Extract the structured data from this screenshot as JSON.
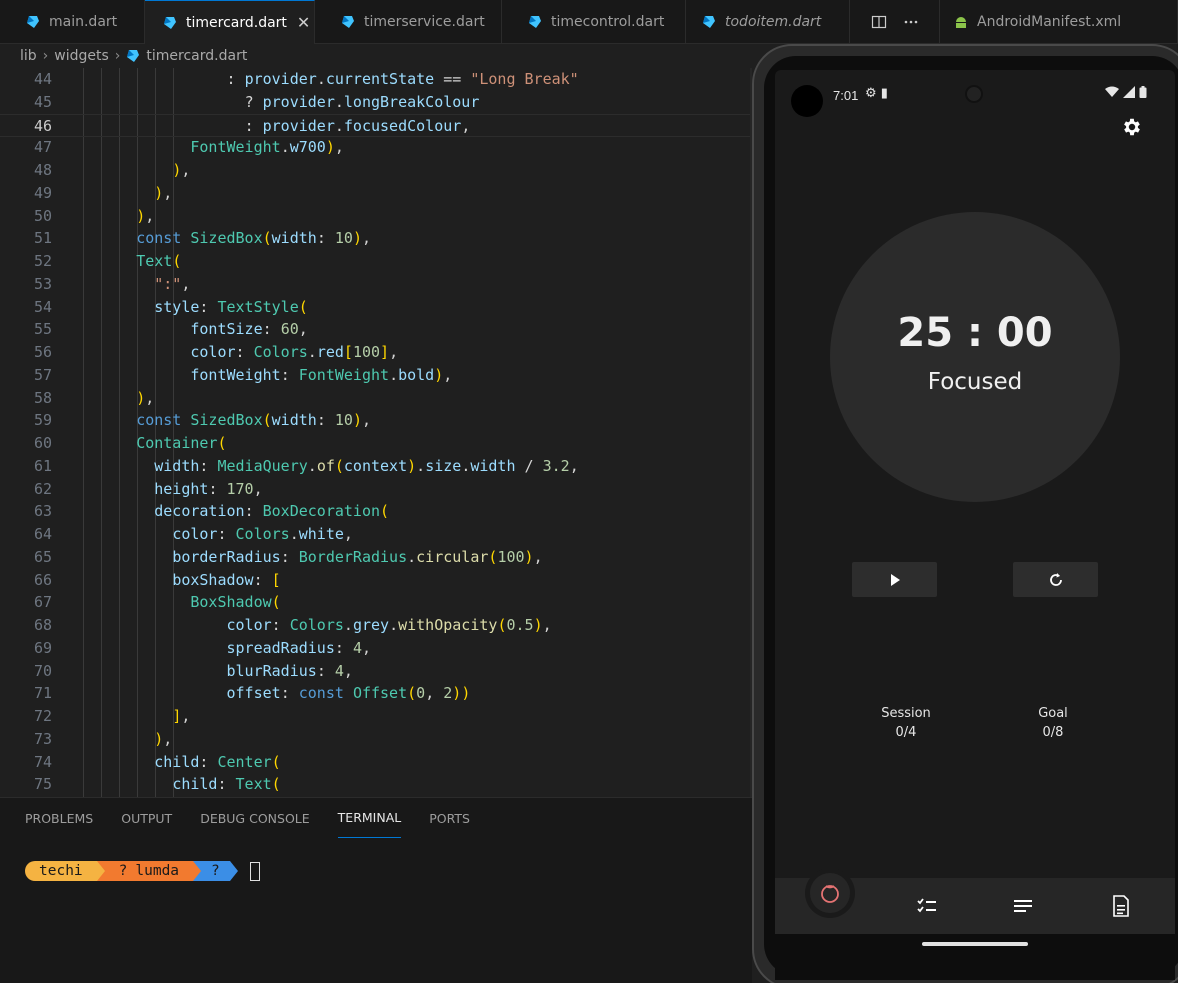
{
  "tabs": [
    {
      "label": "main.dart",
      "active": false,
      "italic": false
    },
    {
      "label": "timercard.dart",
      "active": true,
      "italic": false
    },
    {
      "label": "timerservice.dart",
      "active": false,
      "italic": false
    },
    {
      "label": "timecontrol.dart",
      "active": false,
      "italic": false
    },
    {
      "label": "todoitem.dart",
      "active": false,
      "italic": true
    },
    {
      "label": "AndroidManifest.xml",
      "active": false,
      "italic": false
    }
  ],
  "tab_close_symbol": "✕",
  "tab_action_icons": [
    "split-editor-icon",
    "more-icon"
  ],
  "breadcrumb": {
    "lib": "lib",
    "widgets": "widgets",
    "file": "timercard.dart"
  },
  "editor": {
    "current_line": 46,
    "lines": [
      {
        "n": "44",
        "text": "                : provider.currentState == \"Long Break\""
      },
      {
        "n": "45",
        "text": "                  ? provider.longBreakColour"
      },
      {
        "n": "46",
        "text": "                  : provider.focusedColour,"
      },
      {
        "n": "47",
        "text": "            FontWeight.w700),"
      },
      {
        "n": "48",
        "text": "          ),"
      },
      {
        "n": "49",
        "text": "        ),"
      },
      {
        "n": "50",
        "text": "      ),"
      },
      {
        "n": "51",
        "text": "      const SizedBox(width: 10),"
      },
      {
        "n": "52",
        "text": "      Text("
      },
      {
        "n": "53",
        "text": "        \":\","
      },
      {
        "n": "54",
        "text": "        style: TextStyle("
      },
      {
        "n": "55",
        "text": "            fontSize: 60,"
      },
      {
        "n": "56",
        "text": "            color: Colors.red[100],"
      },
      {
        "n": "57",
        "text": "            fontWeight: FontWeight.bold),"
      },
      {
        "n": "58",
        "text": "      ),"
      },
      {
        "n": "59",
        "text": "      const SizedBox(width: 10),"
      },
      {
        "n": "60",
        "text": "      Container("
      },
      {
        "n": "61",
        "text": "        width: MediaQuery.of(context).size.width / 3.2,"
      },
      {
        "n": "62",
        "text": "        height: 170,"
      },
      {
        "n": "63",
        "text": "        decoration: BoxDecoration("
      },
      {
        "n": "64",
        "text": "          color: Colors.white,"
      },
      {
        "n": "65",
        "text": "          borderRadius: BorderRadius.circular(100),"
      },
      {
        "n": "66",
        "text": "          boxShadow: ["
      },
      {
        "n": "67",
        "text": "            BoxShadow("
      },
      {
        "n": "68",
        "text": "                color: Colors.grey.withOpacity(0.5),"
      },
      {
        "n": "69",
        "text": "                spreadRadius: 4,"
      },
      {
        "n": "70",
        "text": "                blurRadius: 4,"
      },
      {
        "n": "71",
        "text": "                offset: const Offset(0, 2))"
      },
      {
        "n": "72",
        "text": "          ],"
      },
      {
        "n": "73",
        "text": "        ),"
      },
      {
        "n": "74",
        "text": "        child: Center("
      },
      {
        "n": "75",
        "text": "          child: Text("
      }
    ]
  },
  "panel": {
    "tabs": [
      "PROBLEMS",
      "OUTPUT",
      "DEBUG CONSOLE",
      "TERMINAL",
      "PORTS"
    ],
    "active_tab": "TERMINAL",
    "prompt": {
      "user": "techi",
      "dir": "lumda",
      "git": "",
      "glyph": "?"
    }
  },
  "phone": {
    "time": "7:01",
    "status_icons": "⚙ ▮",
    "timer": "25 : 00",
    "state": "Focused",
    "session_label": "Session",
    "session_value": "0/4",
    "goal_label": "Goal",
    "goal_value": "0/8",
    "colors": {
      "background": "#1a1a1a",
      "circle": "#2b2b2b",
      "nav": "#262626"
    }
  },
  "colors": {
    "accent": "#0078d4",
    "editor_bg": "#1f1f1f",
    "prompt_user": "#f5b342",
    "prompt_dir": "#f27a2f",
    "prompt_git": "#3b8ee6"
  }
}
